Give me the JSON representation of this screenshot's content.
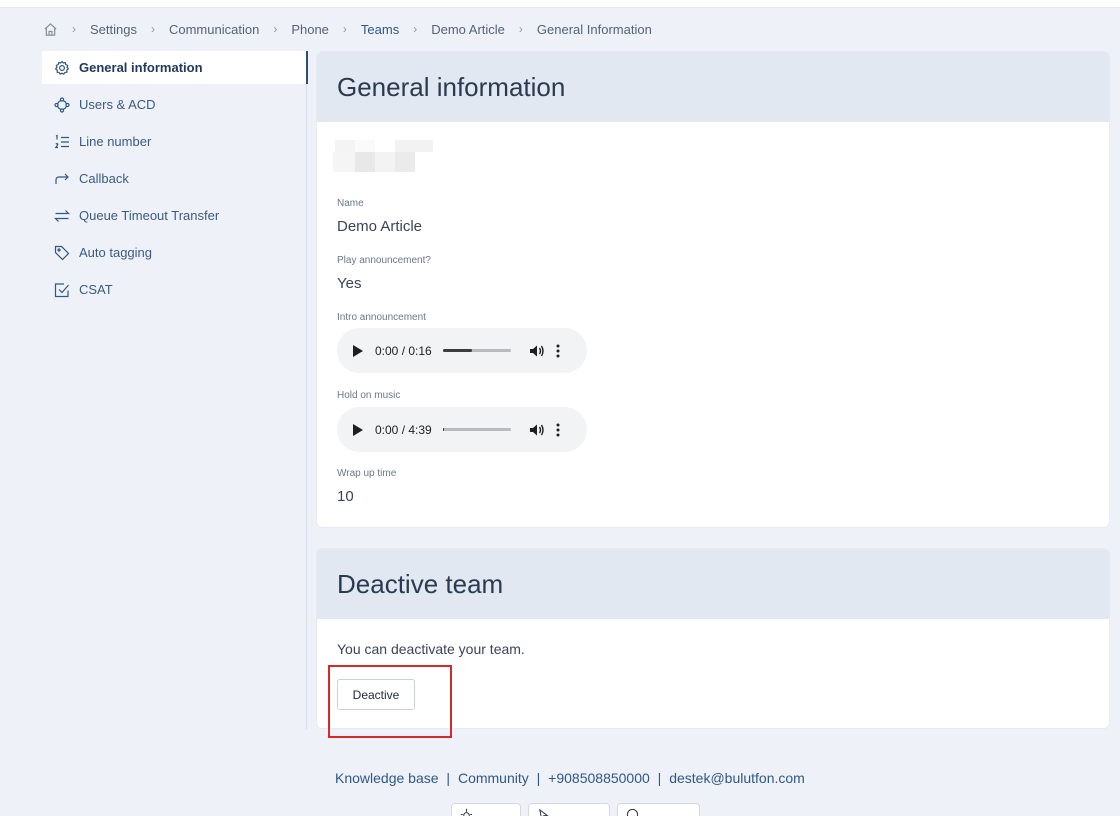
{
  "breadcrumb": {
    "items": [
      "Settings",
      "Communication",
      "Phone",
      "Teams",
      "Demo Article",
      "General Information"
    ],
    "active_index": 3
  },
  "sidebar": {
    "items": [
      {
        "label": "General information",
        "icon": "gear-icon",
        "active": true
      },
      {
        "label": "Users & ACD",
        "icon": "users-network-icon",
        "active": false
      },
      {
        "label": "Line number",
        "icon": "numbered-list-icon",
        "active": false
      },
      {
        "label": "Callback",
        "icon": "forward-arrow-icon",
        "active": false
      },
      {
        "label": "Queue Timeout Transfer",
        "icon": "transfer-arrows-icon",
        "active": false
      },
      {
        "label": "Auto tagging",
        "icon": "tag-icon",
        "active": false
      },
      {
        "label": "CSAT",
        "icon": "checkbox-icon",
        "active": false
      }
    ]
  },
  "general": {
    "title": "General information",
    "name_label": "Name",
    "name_value": "Demo Article",
    "play_label": "Play announcement?",
    "play_value": "Yes",
    "intro_label": "Intro announcement",
    "intro_time": "0:00 / 0:16",
    "intro_progress": 0.42,
    "hold_label": "Hold on music",
    "hold_time": "0:00 / 4:39",
    "hold_progress": 0.02,
    "wrap_label": "Wrap up time",
    "wrap_value": "10"
  },
  "deactive": {
    "title": "Deactive team",
    "description": "You can deactivate your team.",
    "button_label": "Deactive"
  },
  "footer": {
    "knowledge_base": "Knowledge base",
    "community": "Community",
    "phone": "+908508850000",
    "email": "destek@bulutfon.com",
    "separator": "|"
  },
  "colors": {
    "accent": "#2f5784",
    "page_bg": "#eef2f8",
    "card_header_bg": "#e2e8f1",
    "highlight": "#d62a2a"
  }
}
